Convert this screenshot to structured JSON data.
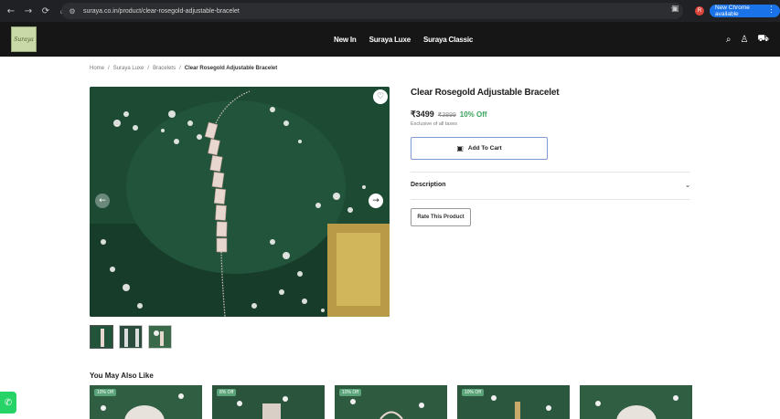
{
  "browser": {
    "back": "←",
    "forward": "→",
    "reload": "⟳",
    "home": "⌂",
    "site_info": "⚙",
    "url": "suraya.co.in/product/clear-rosegold-adjustable-bracelet",
    "bookmark": "☆",
    "extensions": "▣",
    "profile_initial": "R",
    "chrome_button": "New Chrome available",
    "menu": "⋮"
  },
  "header": {
    "logo_text": "Suraya",
    "nav": [
      "New In",
      "Suraya Luxe",
      "Suraya Classic"
    ],
    "icons": {
      "search": "⌕",
      "account": "♙",
      "cart": "⛟"
    }
  },
  "breadcrumb": [
    "Home",
    "/",
    "Suraya Luxe",
    "/",
    "Bracelets",
    "/",
    "Clear Rosegold Adjustable Bracelet"
  ],
  "product": {
    "title": "Clear Rosegold Adjustable Bracelet",
    "price": "₹3499",
    "old_price": "₹3899",
    "discount": "10% Off",
    "tax_note": "Exclusive of all taxes",
    "add_to_cart": "Add To Cart",
    "description_label": "Description",
    "description_chevron": "⌄",
    "rate_label": "Rate This Product"
  },
  "gallery": {
    "wishlist_icon": "♡",
    "prev": "←",
    "next": "→"
  },
  "also": {
    "title": "You May Also Like",
    "badges": [
      "10% Off",
      "8% Off",
      "10% Off",
      "10% Off",
      ""
    ]
  },
  "whatsapp_icon": "✆",
  "colors": {
    "header_bg": "#161616",
    "accent_green": "#3aa35c",
    "cart_border": "#7f9cd4"
  }
}
